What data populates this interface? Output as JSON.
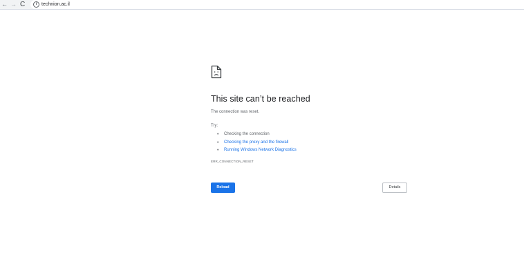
{
  "browser": {
    "nav_back": "←",
    "nav_forward": "→",
    "nav_reload": "C",
    "info_symbol": "i",
    "url": "technion.ac.il"
  },
  "error_page": {
    "icon": "sad-document-icon",
    "title": "This site can’t be reached",
    "message": "The connection was reset.",
    "try_label": "Try:",
    "suggestions": [
      {
        "text": "Checking the connection",
        "link": false
      },
      {
        "text": "Checking the proxy and the firewall",
        "link": true
      },
      {
        "text": "Running Windows Network Diagnostics",
        "link": true
      }
    ],
    "error_code": "ERR_CONNECTION_RESET",
    "reload_label": "Reload",
    "details_label": "Details"
  },
  "colors": {
    "accent": "#1a73e8",
    "text": "#202124",
    "secondary_text": "#5f6368"
  }
}
